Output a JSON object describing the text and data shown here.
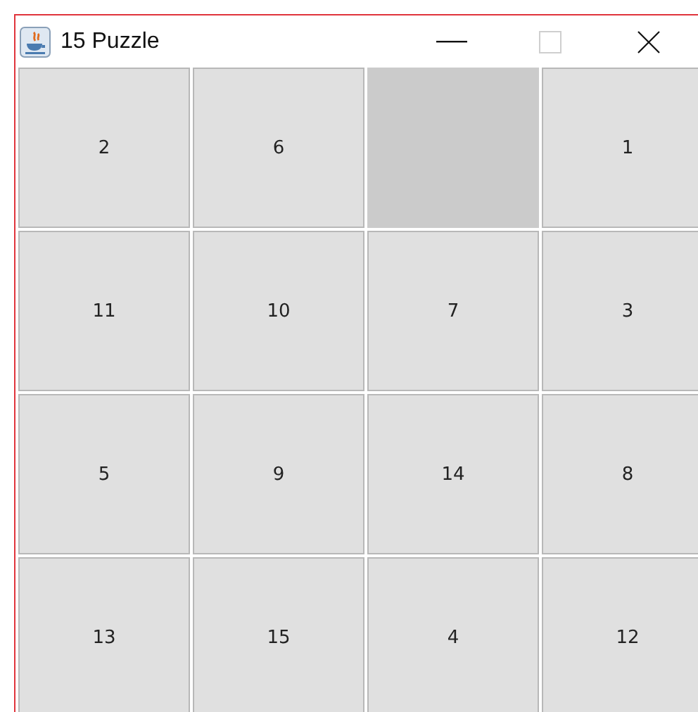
{
  "window": {
    "title": "15 Puzzle",
    "maximize_disabled": true
  },
  "tiles": [
    {
      "kind": "number",
      "label": "2"
    },
    {
      "kind": "number",
      "label": "6"
    },
    {
      "kind": "empty"
    },
    {
      "kind": "number",
      "label": "1"
    },
    {
      "kind": "number",
      "label": "11"
    },
    {
      "kind": "number",
      "label": "10"
    },
    {
      "kind": "number",
      "label": "7"
    },
    {
      "kind": "number",
      "label": "3"
    },
    {
      "kind": "number",
      "label": "5"
    },
    {
      "kind": "number",
      "label": "9"
    },
    {
      "kind": "number",
      "label": "14"
    },
    {
      "kind": "number",
      "label": "8"
    },
    {
      "kind": "number",
      "label": "13"
    },
    {
      "kind": "number",
      "label": "15"
    },
    {
      "kind": "number",
      "label": "4"
    },
    {
      "kind": "number",
      "label": "12"
    }
  ]
}
